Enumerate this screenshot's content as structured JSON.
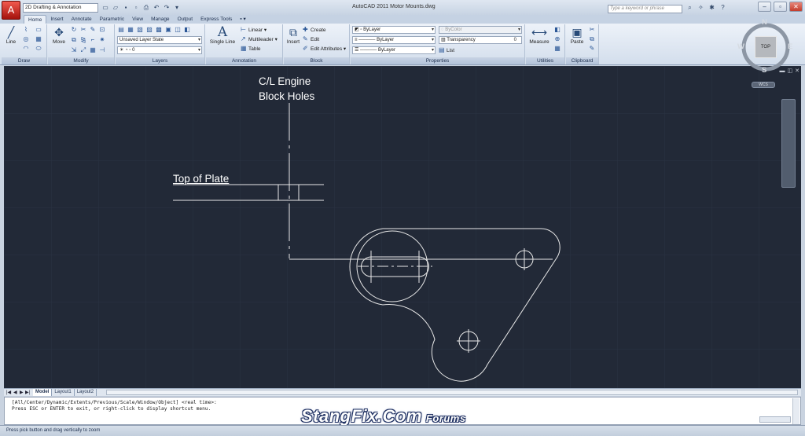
{
  "titlebar": {
    "app_icon": "A",
    "workspace": "2D Drafting & Annotation",
    "quick_access": [
      "new-icon",
      "open-icon",
      "save-icon",
      "saveas-icon",
      "plot-icon",
      "undo-icon",
      "redo-icon",
      "dropdown-icon"
    ],
    "title": "AutoCAD 2011     Motor Mounts.dwg",
    "search_placeholder": "Type a keyword or phrase",
    "title_icons": [
      "binoculars-icon",
      "star-icon",
      "help-icon",
      "arrow-icon"
    ],
    "window_controls": [
      "minimize-icon",
      "restore-icon",
      "close-icon"
    ]
  },
  "tabs": [
    "Home",
    "Insert",
    "Annotate",
    "Parametric",
    "View",
    "Manage",
    "Output",
    "Express Tools"
  ],
  "active_tab": "Home",
  "ribbon": {
    "draw": {
      "label": "Draw",
      "line": "Line"
    },
    "modify": {
      "label": "Modify",
      "move": "Move"
    },
    "layers": {
      "label": "Layers",
      "layer_state": "Unsaved Layer State",
      "current_layer": "0"
    },
    "annotation": {
      "label": "Annotation",
      "single_line": "Single Line",
      "linear": "Linear",
      "multileader": "Multileader",
      "table": "Table"
    },
    "block": {
      "label": "Block",
      "insert": "Insert",
      "create": "Create",
      "edit": "Edit",
      "edit_attributes": "Edit Attributes"
    },
    "properties": {
      "label": "Properties",
      "color": "ByLayer",
      "linetype": "ByLayer",
      "lineweight": "ByLayer",
      "plotstyle": "ByColor",
      "transparency": "Transparency",
      "transparency_value": "0",
      "list": "List"
    },
    "utilities": {
      "label": "Utilities",
      "measure": "Measure"
    },
    "clipboard": {
      "label": "Clipboard",
      "paste": "Paste"
    }
  },
  "drawing": {
    "label_engine_line1": "C/L Engine",
    "label_engine_line2": "Block Holes",
    "label_plate": "Top of Plate",
    "line_color": "#ffffff",
    "background": "#222937"
  },
  "viewcube": {
    "north": "N",
    "south": "S",
    "east": "E",
    "west": "W",
    "face": "TOP",
    "wcs": "WCS"
  },
  "layout_tabs": [
    "Model",
    "Layout1",
    "Layout2"
  ],
  "active_layout": "Model",
  "command": {
    "line1": "[All/Center/Dynamic/Extents/Previous/Scale/Window/Object] <real time>:",
    "line2": "Press ESC or ENTER to exit, or right-click to display shortcut menu."
  },
  "watermark": {
    "main": "StangFix.Com",
    "sub": "Forums"
  },
  "status_text": "Press pick button and drag vertically to zoom"
}
